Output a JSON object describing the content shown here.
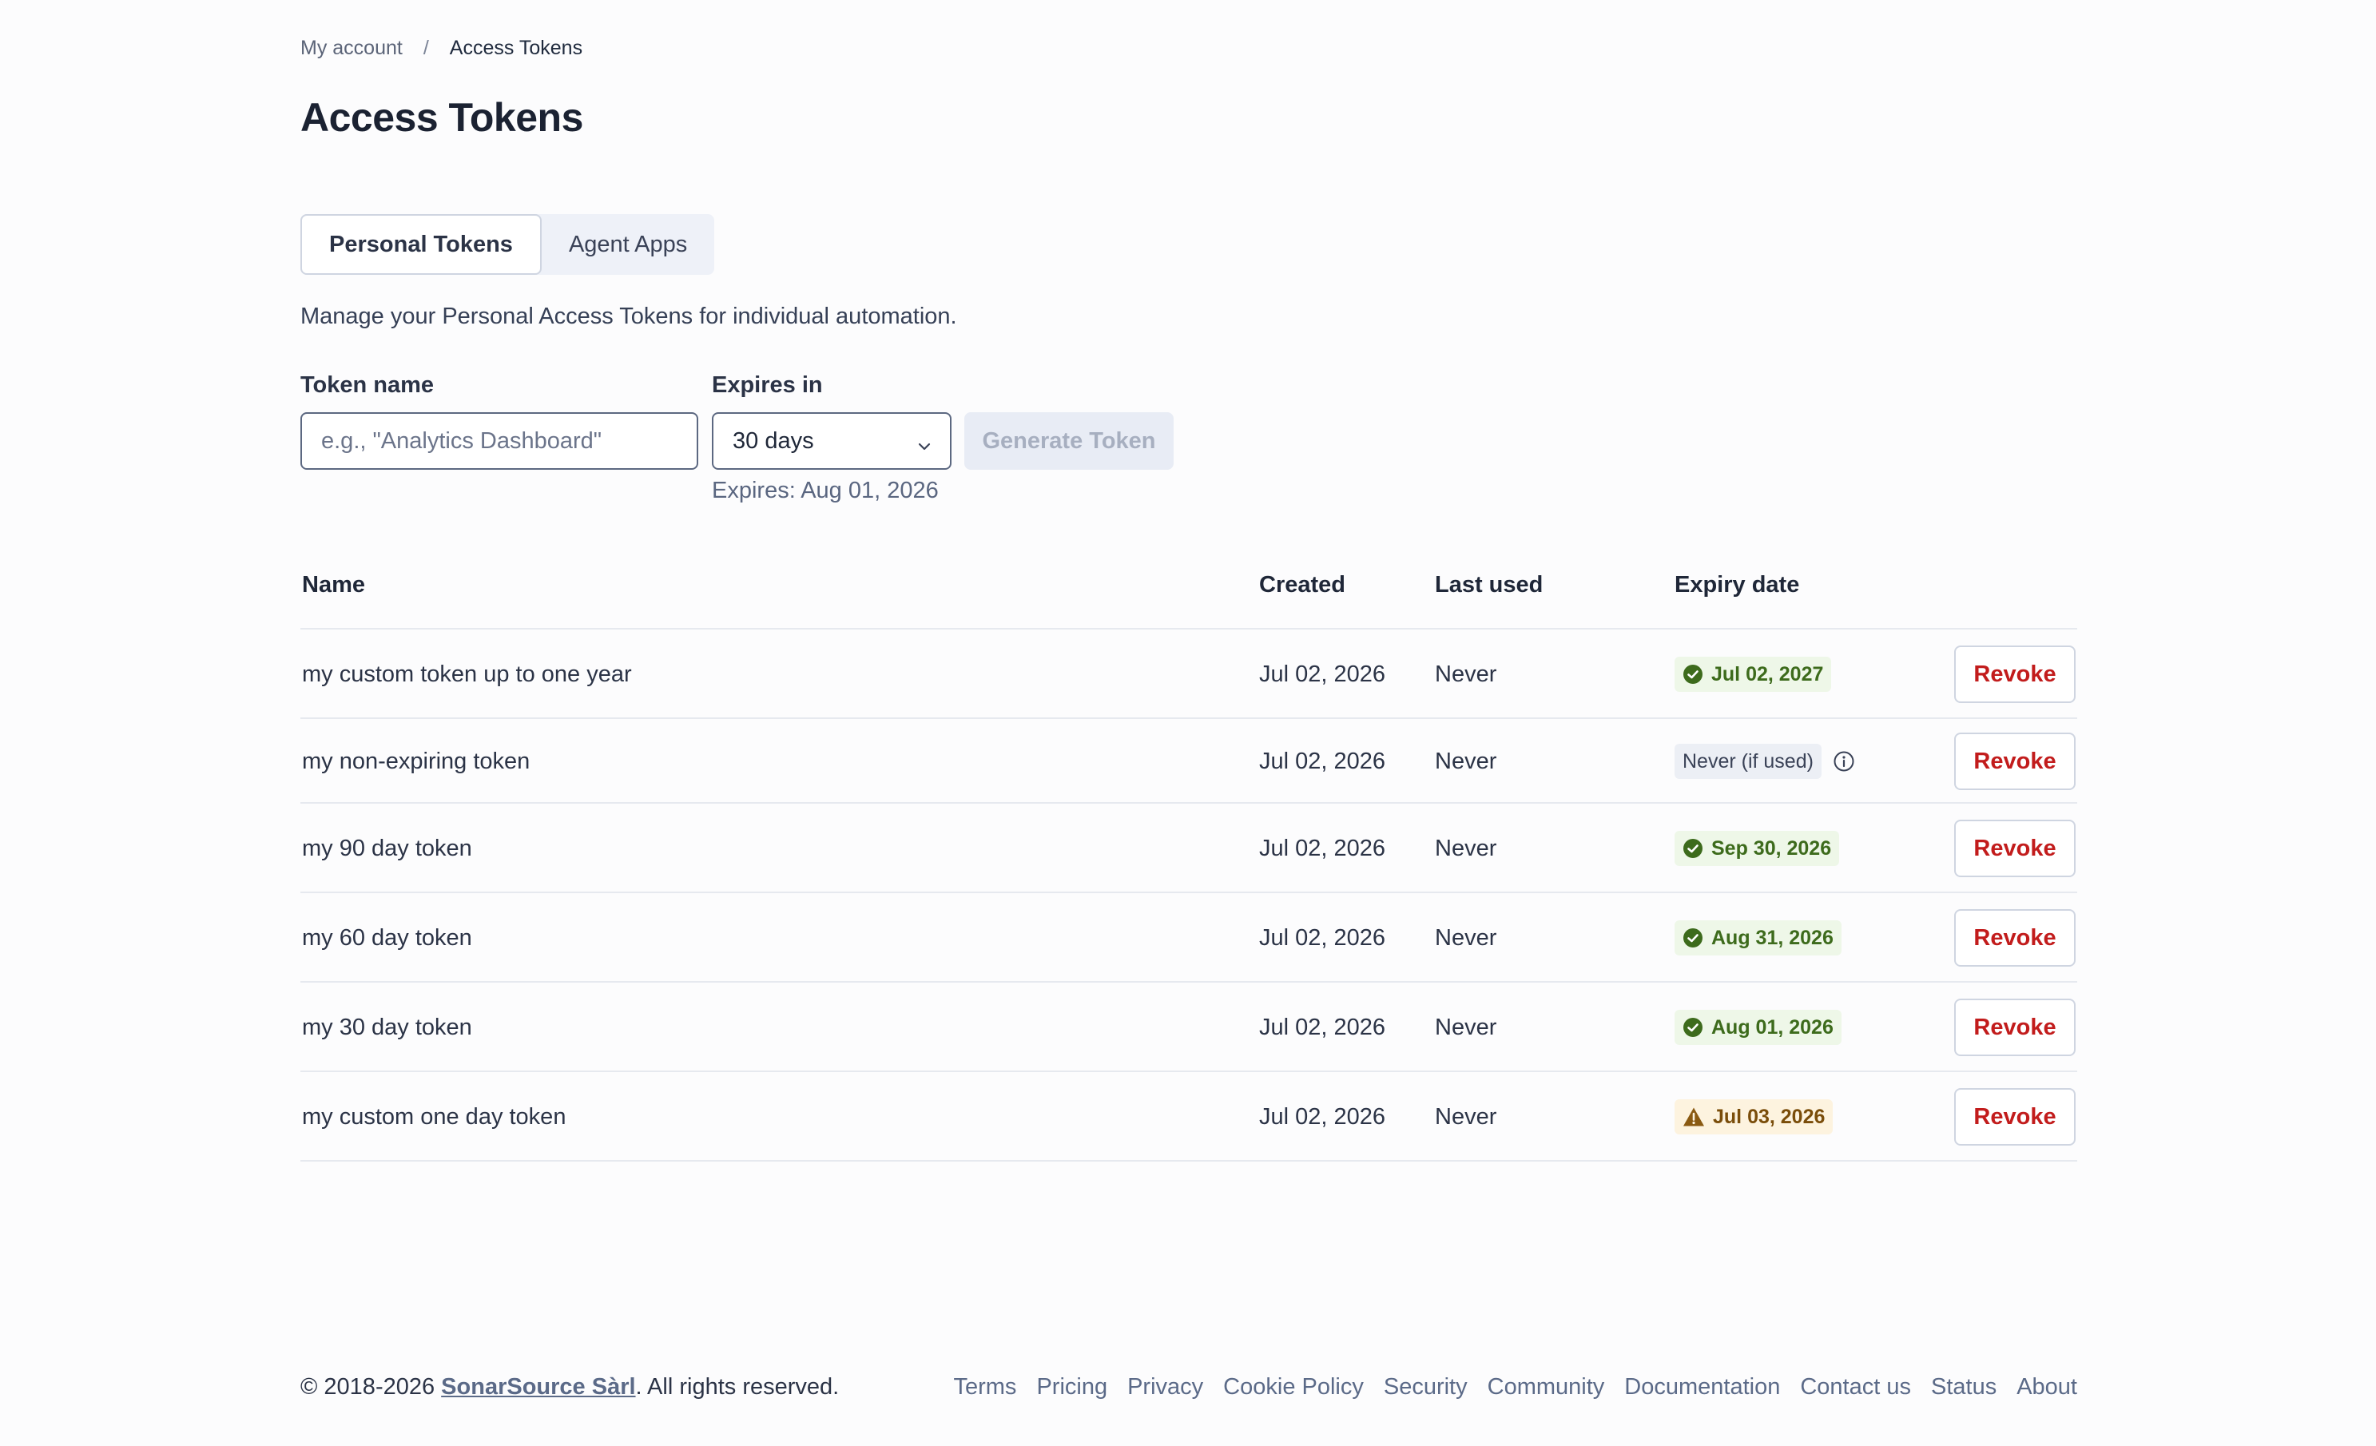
{
  "breadcrumb": {
    "parent": "My account",
    "separator": "/",
    "current": "Access Tokens"
  },
  "page": {
    "title": "Access Tokens"
  },
  "tabs": [
    {
      "label": "Personal Tokens",
      "active": true
    },
    {
      "label": "Agent Apps",
      "active": false
    }
  ],
  "description": "Manage your Personal Access Tokens for individual automation.",
  "form": {
    "token_name_label": "Token name",
    "token_name_placeholder": "e.g., \"Analytics Dashboard\"",
    "expires_label": "Expires in",
    "expires_value": "30 days",
    "generate_label": "Generate Token",
    "expires_note": "Expires: Aug 01, 2026"
  },
  "table": {
    "headers": {
      "name": "Name",
      "created": "Created",
      "last_used": "Last used",
      "expiry": "Expiry date"
    },
    "rows": [
      {
        "name": "my custom token up to one year",
        "created": "Jul 02, 2026",
        "last_used": "Never",
        "expiry": "Jul 02, 2027",
        "status": "ok",
        "action": "Revoke"
      },
      {
        "name": "my non-expiring token",
        "created": "Jul 02, 2026",
        "last_used": "Never",
        "expiry": "Never (if used)",
        "status": "neutral",
        "action": "Revoke"
      },
      {
        "name": "my 90 day token",
        "created": "Jul 02, 2026",
        "last_used": "Never",
        "expiry": "Sep 30, 2026",
        "status": "ok",
        "action": "Revoke"
      },
      {
        "name": "my 60 day token",
        "created": "Jul 02, 2026",
        "last_used": "Never",
        "expiry": "Aug 31, 2026",
        "status": "ok",
        "action": "Revoke"
      },
      {
        "name": "my 30 day token",
        "created": "Jul 02, 2026",
        "last_used": "Never",
        "expiry": "Aug 01, 2026",
        "status": "ok",
        "action": "Revoke"
      },
      {
        "name": "my custom one day token",
        "created": "Jul 02, 2026",
        "last_used": "Never",
        "expiry": "Jul 03, 2026",
        "status": "warn",
        "action": "Revoke"
      }
    ]
  },
  "footer": {
    "copyright_prefix": "© 2018-2026 ",
    "company": "SonarSource Sàrl",
    "copyright_suffix": ". All rights reserved.",
    "links": [
      "Terms",
      "Pricing",
      "Privacy",
      "Cookie Policy",
      "Security",
      "Community",
      "Documentation",
      "Contact us",
      "Status",
      "About"
    ]
  },
  "colors": {
    "ok": "#3d6b1c",
    "warn": "#7a4d0a",
    "danger": "#c21c1c",
    "link": "#5b6a88"
  }
}
